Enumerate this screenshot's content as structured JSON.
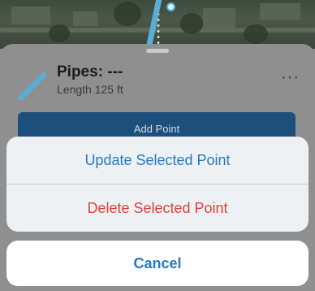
{
  "colors": {
    "accent": "#2679c0",
    "destructive": "#e0403a",
    "add_point_bg": "#1d4f7c",
    "pipe": "#5aaed6"
  },
  "feature": {
    "icon": "pipe-icon",
    "title": "Pipes: ---",
    "subtitle": "Length 125 ft",
    "more_icon": "ellipsis-icon",
    "more_label": "···"
  },
  "toolbar": {
    "add_point_label": "Add Point"
  },
  "action_sheet": {
    "update_label": "Update Selected Point",
    "delete_label": "Delete Selected Point",
    "cancel_label": "Cancel"
  }
}
